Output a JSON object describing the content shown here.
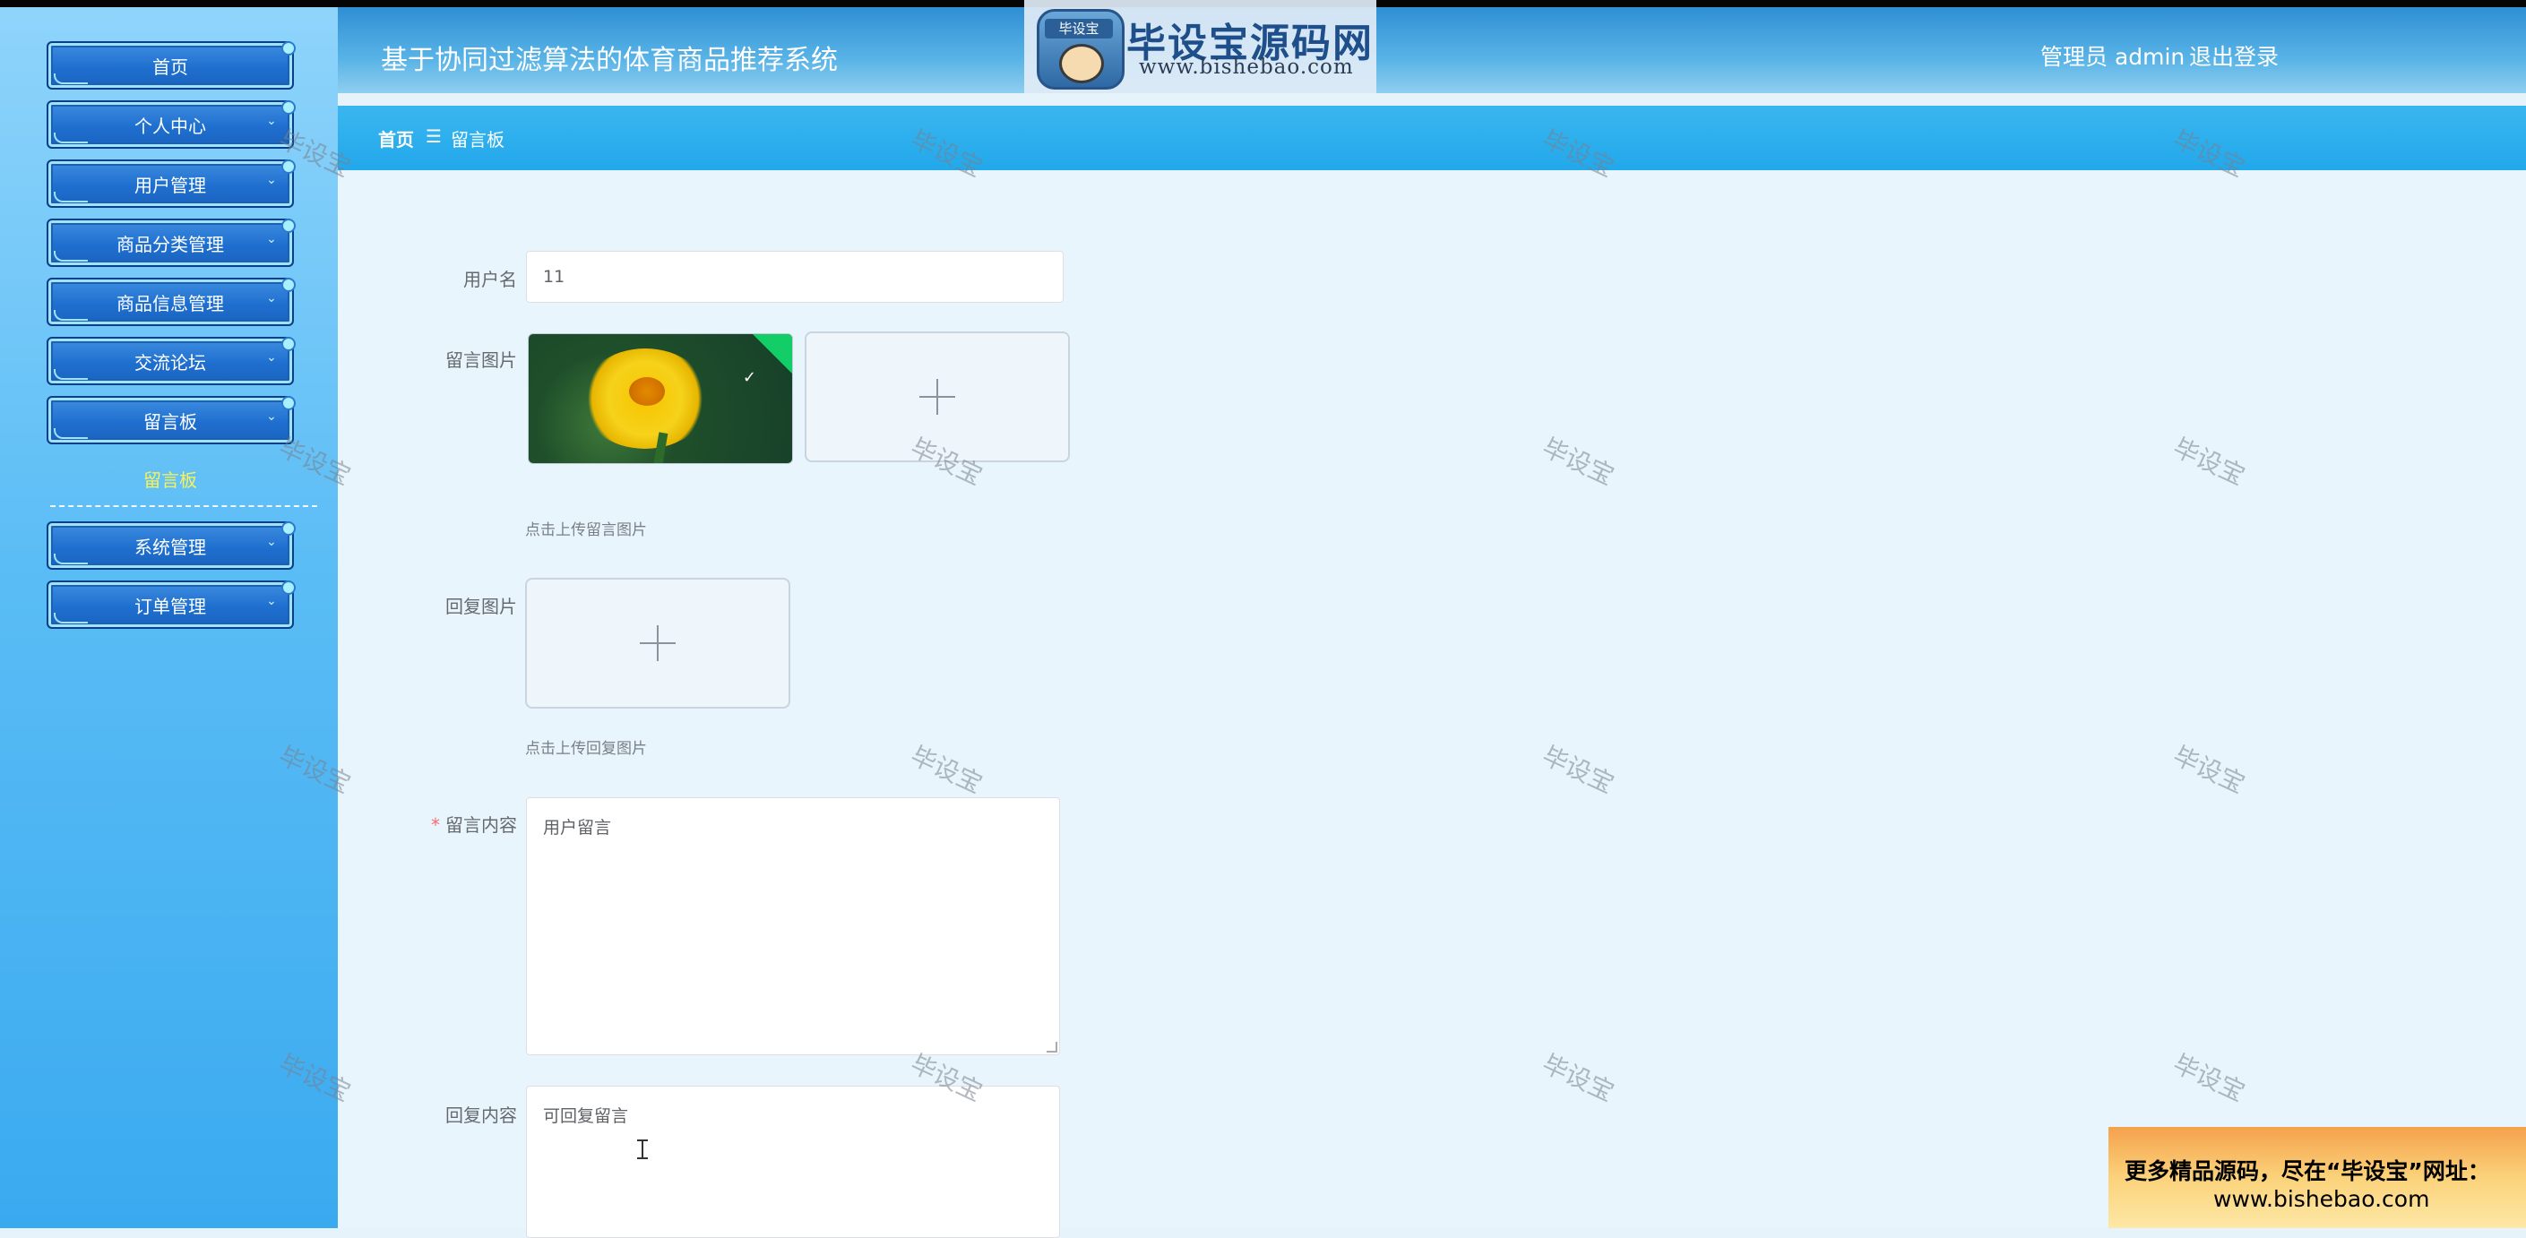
{
  "app": {
    "title": "基于协同过滤算法的体育商品推荐系统",
    "user_text": "管理员 admin",
    "logout_label": "退出登录"
  },
  "logo": {
    "icon_label": "毕设宝",
    "main_text": "毕设宝源码网",
    "url_text": "www.bishebao.com"
  },
  "sidebar": {
    "items": [
      {
        "label": "首页"
      },
      {
        "label": "个人中心"
      },
      {
        "label": "用户管理"
      },
      {
        "label": "商品分类管理"
      },
      {
        "label": "商品信息管理"
      },
      {
        "label": "交流论坛"
      },
      {
        "label": "留言板"
      },
      {
        "label": "系统管理"
      },
      {
        "label": "订单管理"
      }
    ],
    "sub_item": "留言板"
  },
  "breadcrumb": {
    "home": "首页",
    "separator": "☰",
    "current": "留言板"
  },
  "form": {
    "username_label": "用户名",
    "username_value": "11",
    "message_image_label": "留言图片",
    "message_image_tip": "点击上传留言图片",
    "reply_image_label": "回复图片",
    "reply_image_tip": "点击上传回复图片",
    "content_label": "留言内容",
    "content_required_mark": "*",
    "content_value": "用户留言",
    "reply_label": "回复内容",
    "reply_value": "可回复留言"
  },
  "watermark_text": "毕设宝",
  "ad": {
    "line1": "更多精品源码，尽在“毕设宝”网址：",
    "line2": "www.bishebao.com"
  },
  "colors": {
    "sidebar_top": "#8fd4fb",
    "header": "#2f8fd4",
    "breadcrumb_bar": "#22a8ec",
    "main_bg": "#e9f5fc",
    "submenu_active": "#f6f25a",
    "success_green": "#13ce66",
    "required_red": "#f56c6c"
  }
}
